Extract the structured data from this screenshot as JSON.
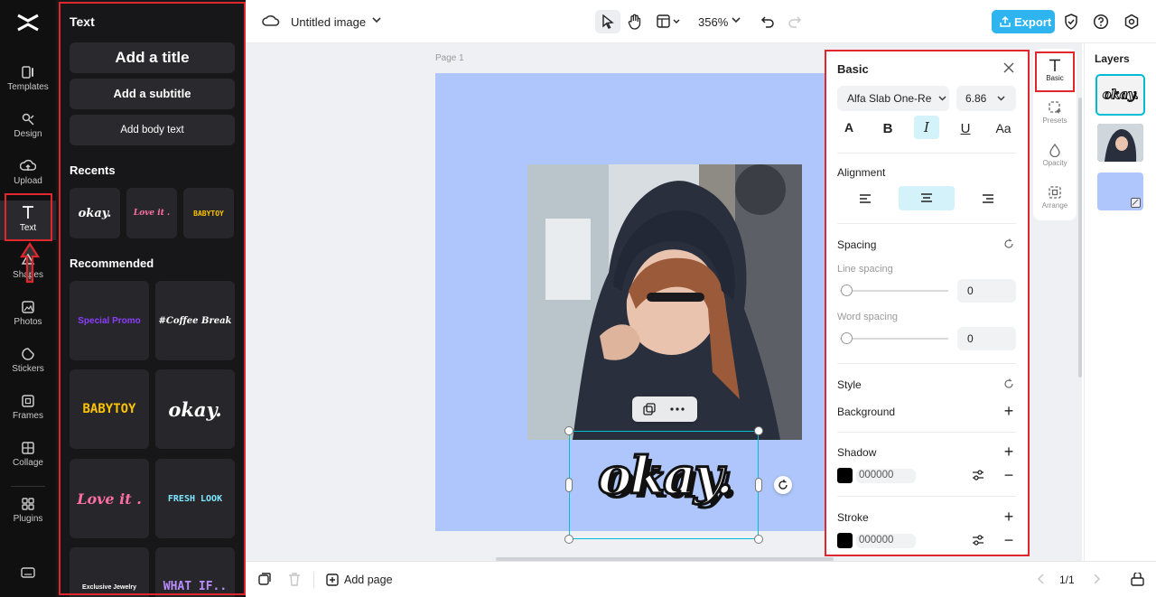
{
  "rail": {
    "items": [
      {
        "label": "Templates",
        "icon": "templates-icon"
      },
      {
        "label": "Design",
        "icon": "design-icon"
      },
      {
        "label": "Upload",
        "icon": "upload-icon"
      },
      {
        "label": "Text",
        "icon": "text-icon"
      },
      {
        "label": "Shapes",
        "icon": "shapes-icon"
      },
      {
        "label": "Photos",
        "icon": "photos-icon"
      },
      {
        "label": "Stickers",
        "icon": "stickers-icon"
      },
      {
        "label": "Frames",
        "icon": "frames-icon"
      },
      {
        "label": "Collage",
        "icon": "collage-icon"
      },
      {
        "label": "Plugins",
        "icon": "plugins-icon"
      }
    ],
    "active": "Text"
  },
  "panel": {
    "title": "Text",
    "add_title": "Add a title",
    "add_subtitle": "Add a subtitle",
    "add_body": "Add body text",
    "recents_heading": "Recents",
    "recents": [
      "okay.",
      "Love it .",
      "BABYTOY"
    ],
    "recommended_heading": "Recommended",
    "recommended": [
      "Special Promo",
      "#Coffee Break",
      "BABYTOY",
      "okay.",
      "Love it .",
      "FRESH LOOK",
      "Exclusive Jewelry",
      "WHAT IF.."
    ]
  },
  "topbar": {
    "doc_title": "Untitled image",
    "zoom": "356%",
    "export_label": "Export"
  },
  "canvas": {
    "page_label": "Page 1",
    "text_content": "okay.",
    "bg_color": "#aec6fb",
    "accent": "#00bcd4"
  },
  "props": {
    "heading": "Basic",
    "font": "Alfa Slab One-Re",
    "font_size": "6.86",
    "alignment_heading": "Alignment",
    "spacing_heading": "Spacing",
    "line_spacing_label": "Line spacing",
    "line_spacing_value": "0",
    "word_spacing_label": "Word spacing",
    "word_spacing_value": "0",
    "style_heading": "Style",
    "background_label": "Background",
    "shadow_label": "Shadow",
    "shadow_color": "000000",
    "stroke_label": "Stroke",
    "stroke_color": "000000"
  },
  "sidetabs": [
    "Basic",
    "Presets",
    "Opacity",
    "Arrange"
  ],
  "layers": {
    "heading": "Layers",
    "thumb_text": "okay."
  },
  "bottombar": {
    "add_page": "Add page",
    "page_count": "1/1"
  }
}
